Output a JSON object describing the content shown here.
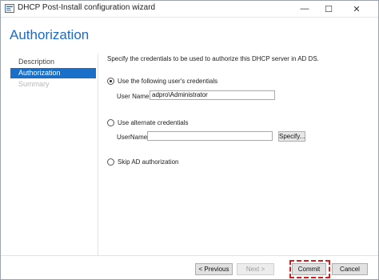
{
  "window": {
    "title": "DHCP Post-Install configuration wizard"
  },
  "title_bar": {
    "minimize_glyph": "—",
    "maximize_glyph": "☐",
    "close_glyph": "✕"
  },
  "header": {
    "title": "Authorization"
  },
  "sidebar": {
    "items": [
      {
        "label": "Description",
        "state": "normal"
      },
      {
        "label": "Authorization",
        "state": "active"
      },
      {
        "label": "Summary",
        "state": "disabled"
      }
    ]
  },
  "main": {
    "intro": "Specify the credentials to be used to authorize this DHCP server in AD DS.",
    "options": {
      "following_user": {
        "label": "Use the following user's credentials",
        "selected": true,
        "user_name_label": "User Name:",
        "user_name_value": "adpro\\Administrator"
      },
      "alternate": {
        "label": "Use alternate credentials",
        "selected": false,
        "user_name_label": "UserName:",
        "user_name_value": "",
        "specify_button": "Specify..."
      },
      "skip": {
        "label": "Skip AD authorization",
        "selected": false
      }
    }
  },
  "footer": {
    "previous_button": "< Previous",
    "next_button": "Next >",
    "commit_button": "Commit",
    "cancel_button": "Cancel"
  },
  "colors": {
    "accent": "#1a6fc9",
    "title_blue": "#1b6ac9",
    "highlight_red": "#d22020"
  },
  "icons": {
    "app": "server-manager-icon"
  }
}
